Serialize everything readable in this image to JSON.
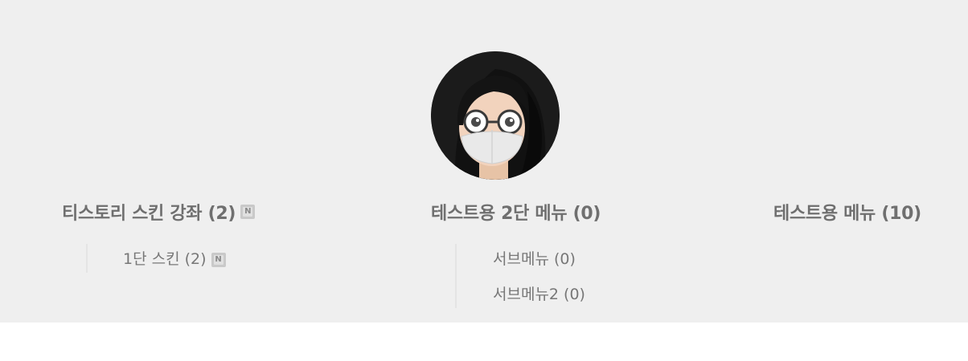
{
  "blog": {
    "avatar": "profile-avatar-memoji"
  },
  "categories": [
    {
      "title": "티스토리 스킨 강좌 (2)",
      "is_new": true,
      "new_badge": "N",
      "children": [
        {
          "label": "1단 스킨 (2)",
          "is_new": true,
          "new_badge": "N"
        }
      ]
    },
    {
      "title": "테스트용 2단 메뉴 (0)",
      "is_new": false,
      "children": [
        {
          "label": "서브메뉴 (0)"
        },
        {
          "label": "서브메뉴2 (0)"
        }
      ]
    },
    {
      "title": "테스트용 메뉴 (10)",
      "is_new": false,
      "children": []
    }
  ],
  "colors": {
    "band_background": "#efefef",
    "page_background": "#ffffff",
    "title_text": "#6f6f6f",
    "sub_text": "#777777",
    "new_badge": "#c9c9c9"
  }
}
